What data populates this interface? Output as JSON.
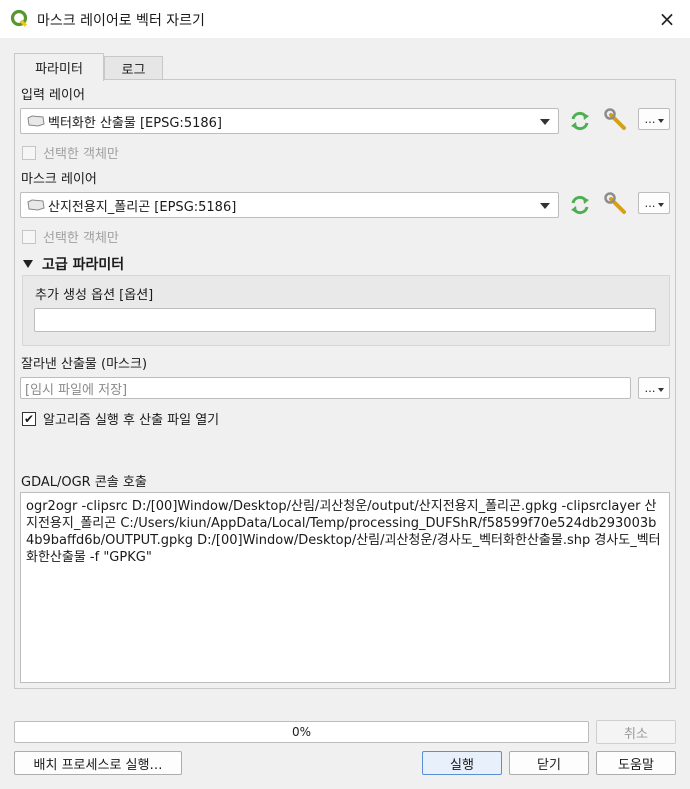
{
  "window": {
    "title": "마스크 레이어로 벡터 자르기",
    "close_icon": "×"
  },
  "tabs": [
    {
      "label": "파라미터",
      "active": true
    },
    {
      "label": "로그",
      "active": false
    }
  ],
  "input_layer": {
    "label": "입력 레이어",
    "value": "벡터화한 산출물 [EPSG:5186]",
    "selected_only": "선택한 객체만",
    "more": "…"
  },
  "mask_layer": {
    "label": "마스크 레이어",
    "value": "산지전용지_폴리곤 [EPSG:5186]",
    "selected_only": "선택한 객체만",
    "more": "…"
  },
  "advanced": {
    "header": "고급 파라미터",
    "extra_options_label": "추가 생성 옵션 [옵션]",
    "extra_options_value": ""
  },
  "output": {
    "label": "잘라낸 산출물 (마스크)",
    "placeholder": "[임시 파일에 저장]",
    "more": "…",
    "open_after": "알고리즘 실행 후 산출 파일 열기",
    "open_after_checked": true
  },
  "console": {
    "label": "GDAL/OGR 콘솔 호출",
    "text": "ogr2ogr -clipsrc D:/[00]Window/Desktop/산림/괴산청운/output/산지전용지_폴리곤.gpkg -clipsrclayer 산지전용지_폴리곤 C:/Users/kiun/AppData/Local/Temp/processing_DUFShR/f58599f70e524db293003b4b9baffd6b/OUTPUT.gpkg D:/[00]Window/Desktop/산림/괴산청운/경사도_벡터화한산출물.shp 경사도_벡터화한산출물 -f \"GPKG\""
  },
  "progress": {
    "percent_label": "0%",
    "value": 0
  },
  "buttons": {
    "cancel": "취소",
    "batch": "배치 프로세스로 실행…",
    "run": "실행",
    "close": "닫기",
    "help": "도움말"
  },
  "colors": {
    "qgis_green": "#589632",
    "qgis_yellow": "#f0c419",
    "refresh_green": "#4caf50"
  }
}
